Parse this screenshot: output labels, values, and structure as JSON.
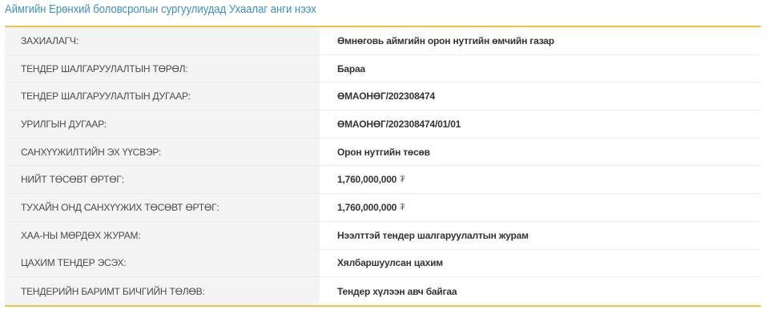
{
  "title": "Аймгийн Ерөнхий боловсролын сургуулиудад Ухаалаг анги нээх",
  "rows": [
    {
      "label": "ЗАХИАЛАГЧ:",
      "value": "Өмнөговь аймгийн орон нутгийн өмчийн газар",
      "currency": ""
    },
    {
      "label": "ТЕНДЕР ШАЛГАРУУЛАЛТЫН ТӨРӨЛ:",
      "value": "Бараа",
      "currency": ""
    },
    {
      "label": "ТЕНДЕР ШАЛГАРУУЛАЛТЫН ДУГААР:",
      "value": "ӨМАОНӨГ/202308474",
      "currency": ""
    },
    {
      "label": "УРИЛГЫН ДУГААР:",
      "value": "ӨМАОНӨГ/202308474/01/01",
      "currency": ""
    },
    {
      "label": "САНХҮҮЖИЛТИЙН ЭХ ҮҮСВЭР:",
      "value": "Орон нутгийн төсөв",
      "currency": ""
    },
    {
      "label": "НИЙТ ТӨСӨВТ ӨРТӨГ:",
      "value": "1,760,000,000",
      "currency": "₮"
    },
    {
      "label": "ТУХАЙН ОНД САНХҮҮЖИХ ТӨСӨВТ ӨРТӨГ:",
      "value": "1,760,000,000",
      "currency": "₮"
    },
    {
      "label": "ХАА-НЫ МӨРДӨХ ЖУРАМ:",
      "value": "Нээлттэй тендер шалгаруулалтын журам",
      "currency": ""
    },
    {
      "label": "ЦАХИМ ТЕНДЕР ЭСЭХ:",
      "value": "Хялбаршуулсан цахим",
      "currency": ""
    },
    {
      "label": "ТЕНДЕРИЙН БАРИМТ БИЧГИЙН ТӨЛӨВ:",
      "value": "Тендер хүлээн авч байгаа",
      "currency": ""
    }
  ],
  "colors": {
    "title": "#3d8fc4",
    "accent_border": "#f5c23f",
    "label_bg": "#f4f4f4"
  }
}
